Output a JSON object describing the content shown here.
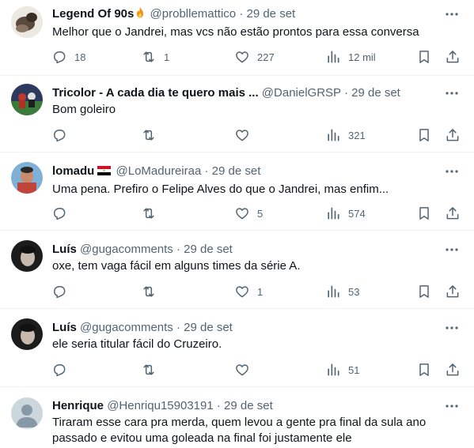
{
  "colors": {
    "text": "#0f1419",
    "muted": "#536471",
    "divider": "#eff3f4"
  },
  "tweets": [
    {
      "name": "Legend Of 90s",
      "name_emoji_icon": "fire-icon",
      "handle": "@probllemattico",
      "dot": "·",
      "date": "29 de set",
      "text": "Melhor que o Jandrei, mas vcs não estão prontos para essa conversa",
      "replies": "18",
      "retweets": "1",
      "likes": "227",
      "views": "12 mil"
    },
    {
      "name": "Tricolor - A cada dia te quero mais ...",
      "handle": "@DanielGRSP",
      "dot": "·",
      "date": "29 de set",
      "text": "Bom goleiro",
      "replies": "",
      "retweets": "",
      "likes": "",
      "views": "321"
    },
    {
      "name": "lomadu",
      "name_emoji_icon": "egypt-flag-icon",
      "handle": "@LoMadureiraa",
      "dot": "·",
      "date": "29 de set",
      "text": "Uma pena. Prefiro o Felipe Alves do que o Jandrei, mas enfim...",
      "replies": "",
      "retweets": "",
      "likes": "5",
      "views": "574"
    },
    {
      "name": "Luís",
      "handle": "@gugacomments",
      "dot": "·",
      "date": "29 de set",
      "text": "oxe, tem vaga fácil em alguns times da série A.",
      "replies": "",
      "retweets": "",
      "likes": "1",
      "views": "53"
    },
    {
      "name": "Luís",
      "handle": "@gugacomments",
      "dot": "·",
      "date": "29 de set",
      "text": "ele seria titular fácil do Cruzeiro.",
      "replies": "",
      "retweets": "",
      "likes": "",
      "views": "51"
    },
    {
      "name": "Henrique",
      "handle": "@Henriqu15903191",
      "dot": "·",
      "date": "29 de set",
      "text": "Tiraram esse cara pra merda, quem levou a gente pra final da sula ano passado e evitou uma goleada na final foi justamente ele"
    }
  ]
}
